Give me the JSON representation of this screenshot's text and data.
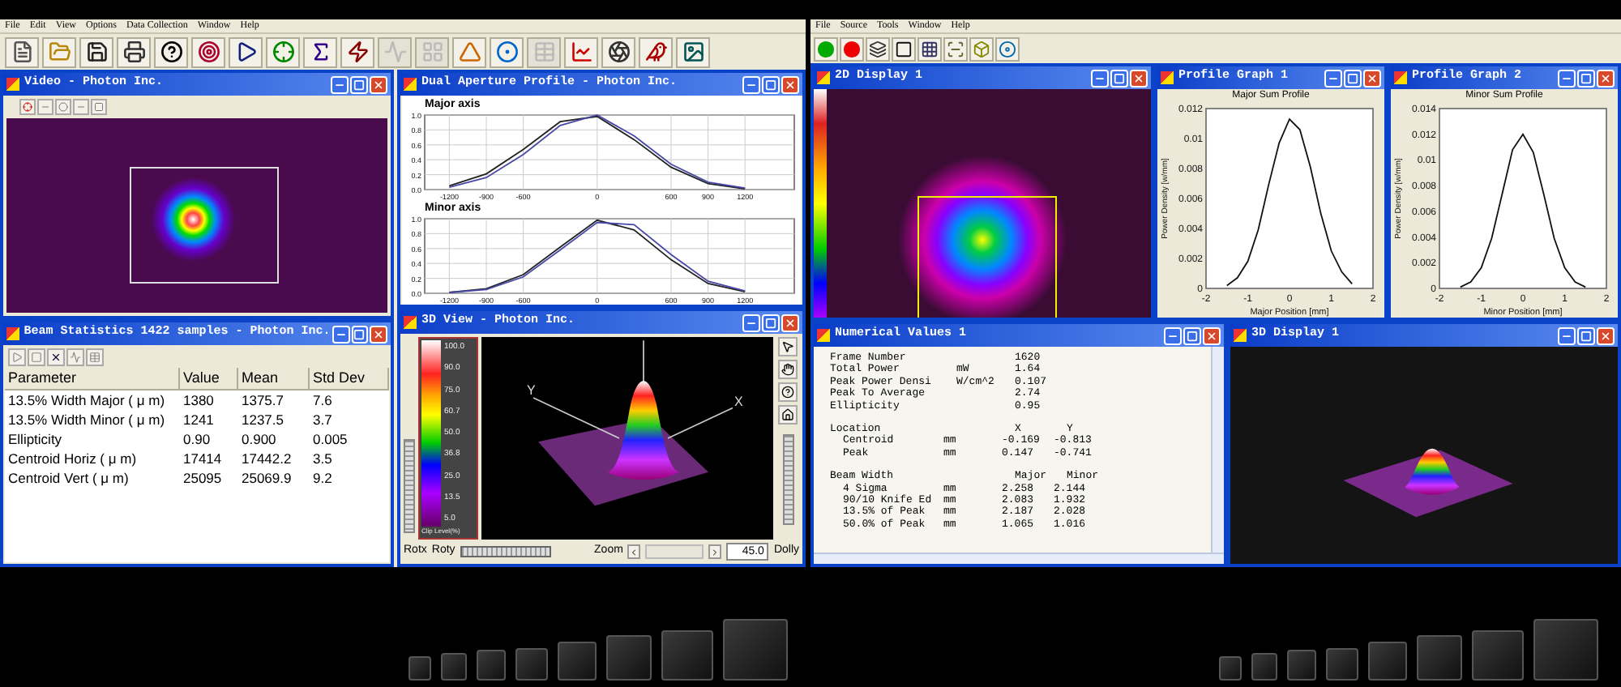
{
  "left_app": {
    "menu": [
      "File",
      "Edit",
      "View",
      "Options",
      "Data Collection",
      "Window",
      "Help"
    ],
    "toolbar": [
      {
        "disabled": false
      },
      {
        "disabled": false
      },
      {
        "disabled": false
      },
      {
        "disabled": false
      },
      {
        "disabled": false
      },
      {
        "disabled": false
      },
      {
        "disabled": false
      },
      {
        "disabled": false
      },
      {
        "disabled": false
      },
      {
        "disabled": false
      },
      {
        "disabled": true
      },
      {
        "disabled": true
      },
      {
        "disabled": false
      },
      {
        "disabled": false
      },
      {
        "disabled": true
      },
      {
        "disabled": false
      },
      {
        "disabled": false
      },
      {
        "disabled": false
      },
      {
        "disabled": false
      }
    ],
    "video": {
      "title": "Video - Photon Inc."
    },
    "dual_profile": {
      "title": "Dual Aperture Profile - Photon Inc.",
      "charts": [
        {
          "chart_data": {
            "type": "line",
            "grid": true,
            "title": "Major axis",
            "x": [
              -1200,
              -900,
              -600,
              -300,
              0,
              300,
              600,
              900,
              1200
            ],
            "xlim": [
              -1400,
              1600
            ],
            "ylim": [
              0,
              1
            ],
            "xticks": [
              -1200,
              -900,
              -600,
              0,
              600,
              900,
              1200
            ],
            "yticks": [
              {
                "value": 0,
                "label": "0.0"
              },
              {
                "value": 0.2,
                "label": "0.2"
              },
              {
                "value": 0.4,
                "label": "0.4"
              },
              {
                "value": 0.6,
                "label": "0.6"
              },
              {
                "value": 0.8,
                "label": "0.8"
              },
              {
                "value": 1,
                "label": "1.0"
              }
            ],
            "series": [
              {
                "color": "#222222",
                "values": [
                  0.05,
                  0.21,
                  0.54,
                  0.91,
                  0.98,
                  0.67,
                  0.3,
                  0.08,
                  0.01
                ]
              },
              {
                "color": "#4848a8",
                "values": [
                  0.03,
                  0.16,
                  0.47,
                  0.86,
                  1.0,
                  0.72,
                  0.34,
                  0.1,
                  0.02
                ]
              }
            ]
          }
        },
        {
          "chart_data": {
            "type": "line",
            "grid": true,
            "title": "Minor axis",
            "x": [
              -1200,
              -900,
              -600,
              -300,
              0,
              300,
              600,
              900,
              1200
            ],
            "xlim": [
              -1400,
              1600
            ],
            "ylim": [
              0,
              1
            ],
            "xticks": [
              -1200,
              -900,
              -600,
              0,
              600,
              900,
              1200
            ],
            "yticks": [
              {
                "value": 0,
                "label": "0.0"
              },
              {
                "value": 0.2,
                "label": "0.2"
              },
              {
                "value": 0.4,
                "label": "0.4"
              },
              {
                "value": 0.6,
                "label": "0.6"
              },
              {
                "value": 0.8,
                "label": "0.8"
              },
              {
                "value": 1,
                "label": "1.0"
              }
            ],
            "series": [
              {
                "color": "#222222",
                "values": [
                  0.01,
                  0.06,
                  0.25,
                  0.62,
                  0.98,
                  0.85,
                  0.45,
                  0.13,
                  0.02
                ]
              },
              {
                "color": "#4848a8",
                "values": [
                  0.01,
                  0.05,
                  0.22,
                  0.58,
                  0.95,
                  0.92,
                  0.52,
                  0.16,
                  0.03
                ]
              }
            ]
          }
        }
      ]
    },
    "beam_stats": {
      "title": "Beam Statistics 1422 samples - Photon Inc.",
      "columns": [
        "Parameter",
        "Value",
        "Mean",
        "Std Dev"
      ],
      "rows": [
        [
          "13.5% Width Major ( μ m)",
          "1380",
          "1375.7",
          "7.6"
        ],
        [
          "13.5% Width Minor ( μ m)",
          "1241",
          "1237.5",
          "3.7"
        ],
        [
          "Ellipticity",
          "0.90",
          "0.900",
          "0.005"
        ],
        [
          "Centroid Horiz ( μ m)",
          "17414",
          "17442.2",
          "3.5"
        ],
        [
          "Centroid Vert ( μ m)",
          "25095",
          "25069.9",
          "9.2"
        ]
      ]
    },
    "view3d": {
      "title": "3D View - Photon Inc.",
      "scale_labels": [
        "100.0",
        "90.0",
        "75.0",
        "60.7",
        "50.0",
        "36.8",
        "25.0",
        "13.5",
        "5.0"
      ],
      "scale_caption": "Clip Level(%)",
      "axis_labels": [
        "Y",
        "X"
      ],
      "controls": {
        "rotx": "Rotx",
        "roty": "Roty",
        "zoom": "Zoom",
        "zoom_value": "45.0",
        "dolly": "Dolly"
      }
    }
  },
  "right_app": {
    "menu": [
      "File",
      "Source",
      "Tools",
      "Window",
      "Help"
    ],
    "display2d": {
      "title": "2D Display 1"
    },
    "profiles": [
      {
        "title": "Profile Graph 1",
        "chart_data": {
          "type": "line",
          "title": "Major Sum Profile",
          "xlabel": "Major Position [mm]",
          "ylabel": "Power Density [w/mm]",
          "x": [
            -1.5,
            -1.25,
            -1,
            -0.75,
            -0.5,
            -0.25,
            0,
            0.25,
            0.5,
            0.75,
            1,
            1.25,
            1.5
          ],
          "xlim": [
            -2,
            2
          ],
          "ylim": [
            0,
            0.012
          ],
          "xticks": [
            -2,
            -1,
            0,
            1,
            2
          ],
          "yticks": [
            0,
            0.002,
            0.004,
            0.006,
            0.008,
            0.01,
            0.012
          ],
          "series": [
            {
              "color": "#111111",
              "values": [
                0.0002,
                0.0007,
                0.0018,
                0.0039,
                0.0069,
                0.0097,
                0.0113,
                0.0106,
                0.0081,
                0.005,
                0.0025,
                0.0011,
                0.0003
              ]
            }
          ]
        }
      },
      {
        "title": "Profile Graph 2",
        "chart_data": {
          "type": "line",
          "title": "Minor Sum Profile",
          "xlabel": "Minor Position [mm]",
          "ylabel": "Power Density [w/mm]",
          "x": [
            -1.5,
            -1.25,
            -1,
            -0.75,
            -0.5,
            -0.25,
            0,
            0.25,
            0.5,
            0.75,
            1,
            1.25,
            1.5
          ],
          "xlim": [
            -2,
            2
          ],
          "ylim": [
            0,
            0.014
          ],
          "xticks": [
            -2,
            -1,
            0,
            1,
            2
          ],
          "yticks": [
            0,
            0.002,
            0.004,
            0.006,
            0.008,
            0.01,
            0.012,
            0.014
          ],
          "series": [
            {
              "color": "#111111",
              "values": [
                0.0001,
                0.0005,
                0.0016,
                0.0039,
                0.0073,
                0.0108,
                0.012,
                0.0106,
                0.0073,
                0.0039,
                0.0016,
                0.0005,
                0.0001
              ]
            }
          ]
        }
      }
    ],
    "numerical": {
      "title": "Numerical Values 1",
      "groups": [
        {
          "rows": [
            {
              "label": "Frame Number",
              "unit": "",
              "values": [
                "1620"
              ]
            },
            {
              "label": "Total Power",
              "unit": "mW",
              "values": [
                "1.64"
              ]
            },
            {
              "label": "Peak Power Densi",
              "unit": "W/cm^2",
              "values": [
                "0.107"
              ]
            },
            {
              "label": "Peak To Average",
              "unit": "",
              "values": [
                "2.74"
              ]
            },
            {
              "label": "Ellipticity",
              "unit": "",
              "values": [
                "0.95"
              ]
            }
          ]
        },
        {
          "rows": [
            {
              "label": "Location",
              "unit": "",
              "values": [
                "X",
                "Y"
              ],
              "children": [
                {
                  "label": "Centroid",
                  "unit": "mm",
                  "values": [
                    "-0.169",
                    "-0.813"
                  ]
                },
                {
                  "label": "Peak",
                  "unit": "mm",
                  "values": [
                    "0.147",
                    "-0.741"
                  ]
                }
              ]
            }
          ]
        },
        {
          "rows": [
            {
              "label": "Beam Width",
              "unit": "",
              "values": [
                "Major",
                "Minor"
              ],
              "children": [
                {
                  "label": "4 Sigma",
                  "unit": "mm",
                  "values": [
                    "2.258",
                    "2.144"
                  ]
                },
                {
                  "label": "90/10 Knife Ed",
                  "unit": "mm",
                  "values": [
                    "2.083",
                    "1.932"
                  ]
                },
                {
                  "label": "13.5% of Peak",
                  "unit": "mm",
                  "values": [
                    "2.187",
                    "2.028"
                  ]
                },
                {
                  "label": "50.0% of Peak",
                  "unit": "mm",
                  "values": [
                    "1.065",
                    "1.016"
                  ]
                }
              ]
            }
          ]
        }
      ]
    },
    "display3d": {
      "title": "3D Display 1"
    }
  }
}
